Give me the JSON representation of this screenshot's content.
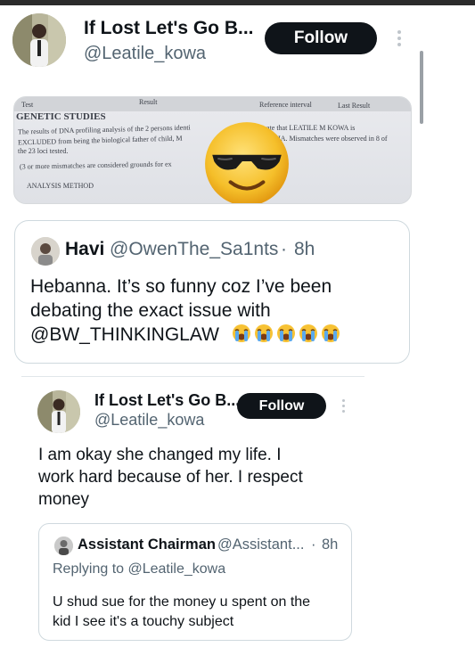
{
  "tweet": {
    "author_name": "If Lost Let's Go B...",
    "author_handle": "@Leatile_kowa",
    "follow_label": "Follow",
    "image": {
      "col_test": "Test",
      "col_result": "Result",
      "col_reference": "Reference interval",
      "col_last": "Last Result",
      "section": "GENETIC STUDIES",
      "line1": "The results of DNA profiling analysis of the 2 persons identi",
      "line1_right": "ate that LEATILE M KOWA is",
      "line2": "EXCLUDED from being the biological father of child, M",
      "line2_right": "HA. Mismatches were observed in 8 of",
      "line3": "the 23 loci tested.",
      "line4": "(3 or more mismatches are considered grounds for ex",
      "line5": "ANALYSIS METHOD"
    }
  },
  "quote1": {
    "name": "Havi",
    "handle": "@OwenThe_Sa1nts",
    "separator": "·",
    "time": "8h",
    "body_line1": "Hebanna. It’s so funny coz I’ve been",
    "body_line2": "debating the exact issue with",
    "body_line3": "@BW_THINKINGLAW"
  },
  "reply": {
    "author_name": "If Lost Let's Go B...",
    "author_handle": "@Leatile_kowa",
    "follow_label": "Follow",
    "body_line1": "I am okay she changed my life. I",
    "body_line2": "work hard because of her. I respect",
    "body_line3": "money"
  },
  "quote2": {
    "name": "Assistant Chairman",
    "handle": "@Assistant...",
    "separator": "·",
    "time": "8h",
    "replying_to": "Replying to @Leatile_kowa",
    "body_line1": "U shud sue for the money u spent on the",
    "body_line2": "kid I see it's a touchy subject"
  },
  "icons": {
    "emoji_overlay": "smiling-face-with-sunglasses-icon",
    "crying": "loudly-crying-face-icon",
    "more": "more-vertical-icon"
  },
  "colors": {
    "follow_bg": "#0f1419",
    "secondary_text": "#536471",
    "border": "#cfd9de"
  }
}
